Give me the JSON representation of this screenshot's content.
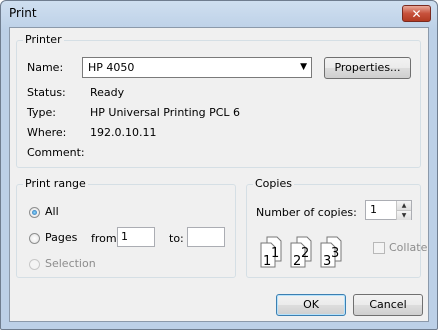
{
  "window": {
    "title": "Print",
    "close_symbol": "✕"
  },
  "printer": {
    "group_label": "Printer",
    "name_label": "Name:",
    "name_value": "HP 4050",
    "properties_button": "Properties...",
    "status_label": "Status:",
    "status_value": "Ready",
    "type_label": "Type:",
    "type_value": "HP Universal Printing PCL 6",
    "where_label": "Where:",
    "where_value": "192.0.10.11",
    "comment_label": "Comment:",
    "comment_value": ""
  },
  "print_range": {
    "group_label": "Print range",
    "all_label": "All",
    "pages_label": "Pages",
    "from_label": "from:",
    "from_value": "1",
    "to_label": "to:",
    "to_value": "",
    "selection_label": "Selection",
    "selected": "All"
  },
  "copies": {
    "group_label": "Copies",
    "number_label": "Number of copies:",
    "number_value": "1",
    "collate_label": "Collate",
    "collate_checked": false,
    "collate_pages": [
      "1",
      "1",
      "2",
      "2",
      "3",
      "3"
    ]
  },
  "buttons": {
    "ok": "OK",
    "cancel": "Cancel"
  },
  "colors": {
    "title_gradient_top": "#cfdff0",
    "title_gradient_bottom": "#bcd0e7",
    "close_button": "#c7513c",
    "panel_bg": "#f0f0f0",
    "default_button_border": "#3c7fb1"
  }
}
